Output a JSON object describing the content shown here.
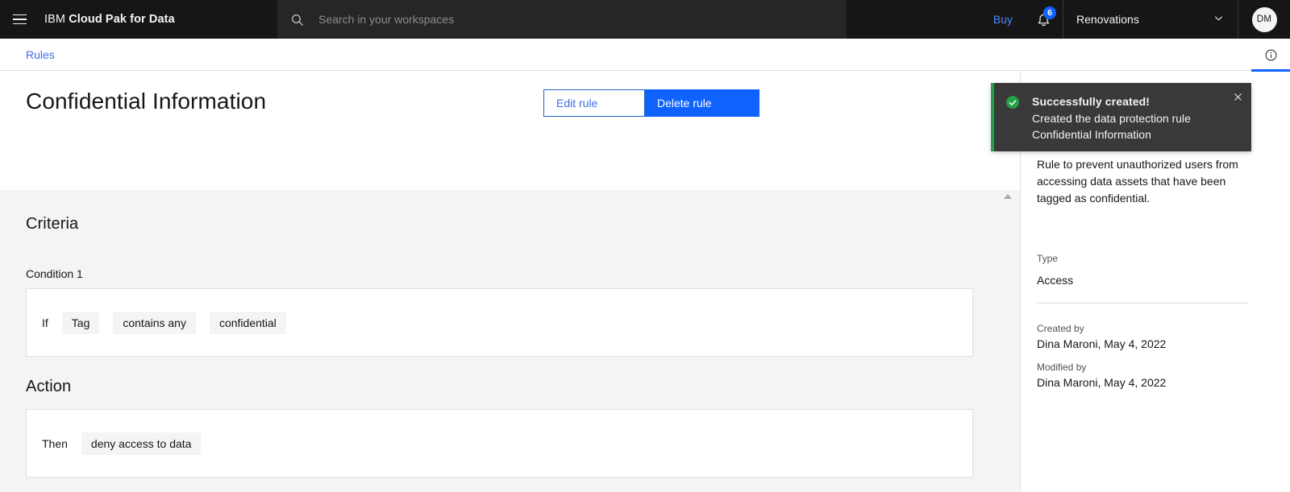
{
  "header": {
    "menu_icon": "hamburger-menu-icon",
    "brand_thin": "IBM",
    "brand_bold": "Cloud Pak for Data",
    "search": {
      "icon": "search-icon",
      "placeholder": "Search in your workspaces",
      "value": ""
    },
    "buy_label": "Buy",
    "notifications": {
      "icon": "bell-icon",
      "count": "6"
    },
    "workspace": {
      "label": "Renovations",
      "chevron": "chevron-down-icon"
    },
    "avatar_initials": "DM"
  },
  "breadcrumb": {
    "items": [
      {
        "label": "Rules"
      }
    ],
    "info_icon": "information-icon"
  },
  "page": {
    "title": "Confidential Information",
    "actions": {
      "edit_label": "Edit rule",
      "delete_label": "Delete rule"
    }
  },
  "criteria": {
    "heading": "Criteria",
    "condition_label": "Condition 1",
    "keyword": "If",
    "chips": [
      "Tag",
      "contains any",
      "confidential"
    ]
  },
  "action": {
    "heading": "Action",
    "keyword": "Then",
    "chips": [
      "deny access to data"
    ]
  },
  "side_panel": {
    "description": "Rule to prevent unauthorized users from accessing data assets that have been tagged as confidential.",
    "type_label": "Type",
    "type_value": "Access",
    "created_label": "Created by",
    "created_value": "Dina Maroni, May 4, 2022",
    "modified_label": "Modified by",
    "modified_value": "Dina Maroni, May 4, 2022"
  },
  "toast": {
    "status_icon": "checkmark-filled-icon",
    "title": "Successfully created!",
    "subtitle": "Created the data protection rule Confidential Information",
    "close_icon": "close-icon"
  },
  "colors": {
    "header_bg": "#161616",
    "accent_blue": "#0f62fe",
    "link_blue": "#3b6fe0",
    "success_green": "#24a148",
    "content_bg": "#f4f4f4",
    "toast_bg": "#393939"
  }
}
